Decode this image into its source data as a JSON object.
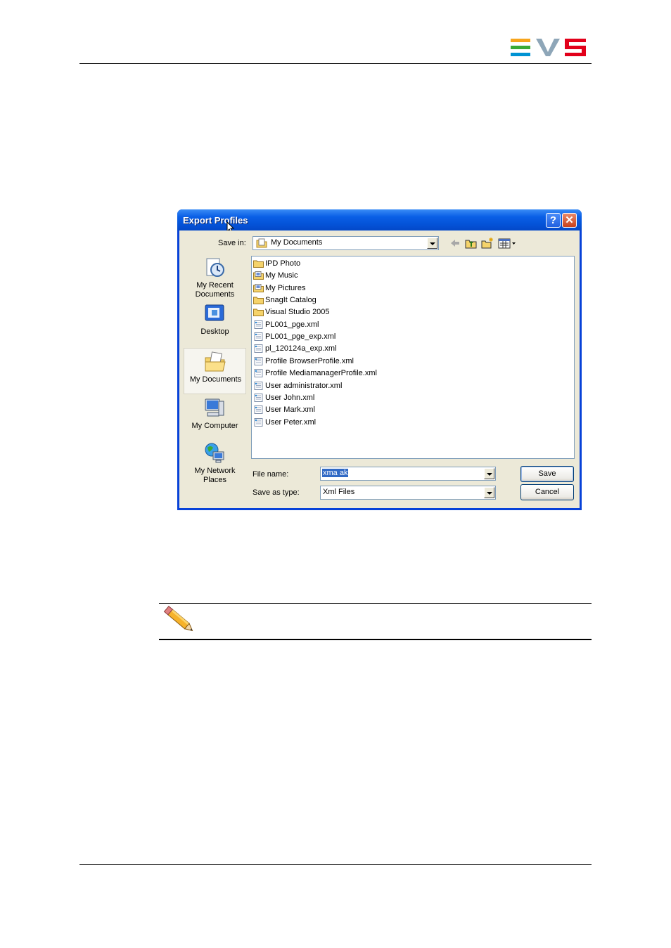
{
  "header": {
    "logo_text": "EVS",
    "logo_colors": [
      "#f7a51c",
      "#3aaa35",
      "#0093d3",
      "#e2001a"
    ]
  },
  "dialog": {
    "title": "Export Profiles",
    "help_label": "?",
    "close_label": "✕",
    "save_in_label": "Save in:",
    "save_in_value": "My Documents",
    "places": [
      {
        "label": "My Recent Documents",
        "icon": "recent-documents-icon"
      },
      {
        "label": "Desktop",
        "icon": "desktop-icon"
      },
      {
        "label": "My Documents",
        "icon": "my-documents-icon",
        "selected": true
      },
      {
        "label": "My Computer",
        "icon": "my-computer-icon"
      },
      {
        "label": "My Network Places",
        "icon": "network-places-icon"
      }
    ],
    "files": [
      {
        "name": "IPD Photo",
        "type": "folder"
      },
      {
        "name": "My Music",
        "type": "special-folder"
      },
      {
        "name": "My Pictures",
        "type": "special-folder"
      },
      {
        "name": "SnagIt Catalog",
        "type": "folder"
      },
      {
        "name": "Visual Studio 2005",
        "type": "folder"
      },
      {
        "name": "PL001_pge.xml",
        "type": "xml"
      },
      {
        "name": "PL001_pge_exp.xml",
        "type": "xml"
      },
      {
        "name": "pl_120124a_exp.xml",
        "type": "xml"
      },
      {
        "name": "Profile BrowserProfile.xml",
        "type": "xml"
      },
      {
        "name": "Profile MediamanagerProfile.xml",
        "type": "xml"
      },
      {
        "name": "User administrator.xml",
        "type": "xml"
      },
      {
        "name": "User John.xml",
        "type": "xml"
      },
      {
        "name": "User Mark.xml",
        "type": "xml"
      },
      {
        "name": "User Peter.xml",
        "type": "xml"
      }
    ],
    "file_name_label": "File name:",
    "file_name_value": "xma ak",
    "save_as_type_label": "Save as type:",
    "save_as_type_value": "Xml Files",
    "save_button": "Save",
    "cancel_button": "Cancel"
  }
}
